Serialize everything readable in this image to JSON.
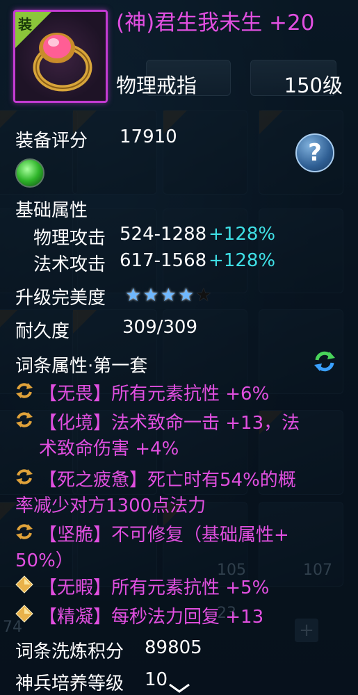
{
  "background": {
    "slot_numbers": [
      "105",
      "107",
      "74",
      "23"
    ]
  },
  "item": {
    "name": "(神)君生我未生 +20",
    "type": "物理戒指",
    "level": "150级",
    "equip_badge": "装"
  },
  "score": {
    "label": "装备评分",
    "value": "17910"
  },
  "base_attrs": {
    "heading": "基础属性",
    "rows": [
      {
        "label": "物理攻击",
        "value": "524-1288",
        "bonus": "+128%"
      },
      {
        "label": "法术攻击",
        "value": "617-1568",
        "bonus": "+128%"
      }
    ]
  },
  "perfection": {
    "label": "升级完美度",
    "stars_filled": 4,
    "stars_total": 5
  },
  "durability": {
    "label": "耐久度",
    "value": "309/309"
  },
  "affix": {
    "heading": "词条属性·第一套",
    "lines": [
      "【无畏】所有元素抗性 +6%",
      "【化境】法术致命一击 +13，法",
      "术致命伤害 +4%",
      "【死之疲惫】死亡时有54%的概",
      "率减少对方1300点法力",
      "【坚脆】不可修复（基础属性+",
      "50%）",
      "【无暇】所有元素抗性 +5%",
      "【精凝】每秒法力回复 +13"
    ]
  },
  "refine_points": {
    "label": "词条洗炼积分",
    "value": "89805"
  },
  "cultivation": {
    "label": "神兵培养等级",
    "value": "10"
  },
  "help_label": "?",
  "colors": {
    "name_magenta": "#e14fe0",
    "bonus_cyan": "#3fe0e6",
    "frame_purple": "#c43bd3",
    "equip_green": "#8bc63a"
  }
}
